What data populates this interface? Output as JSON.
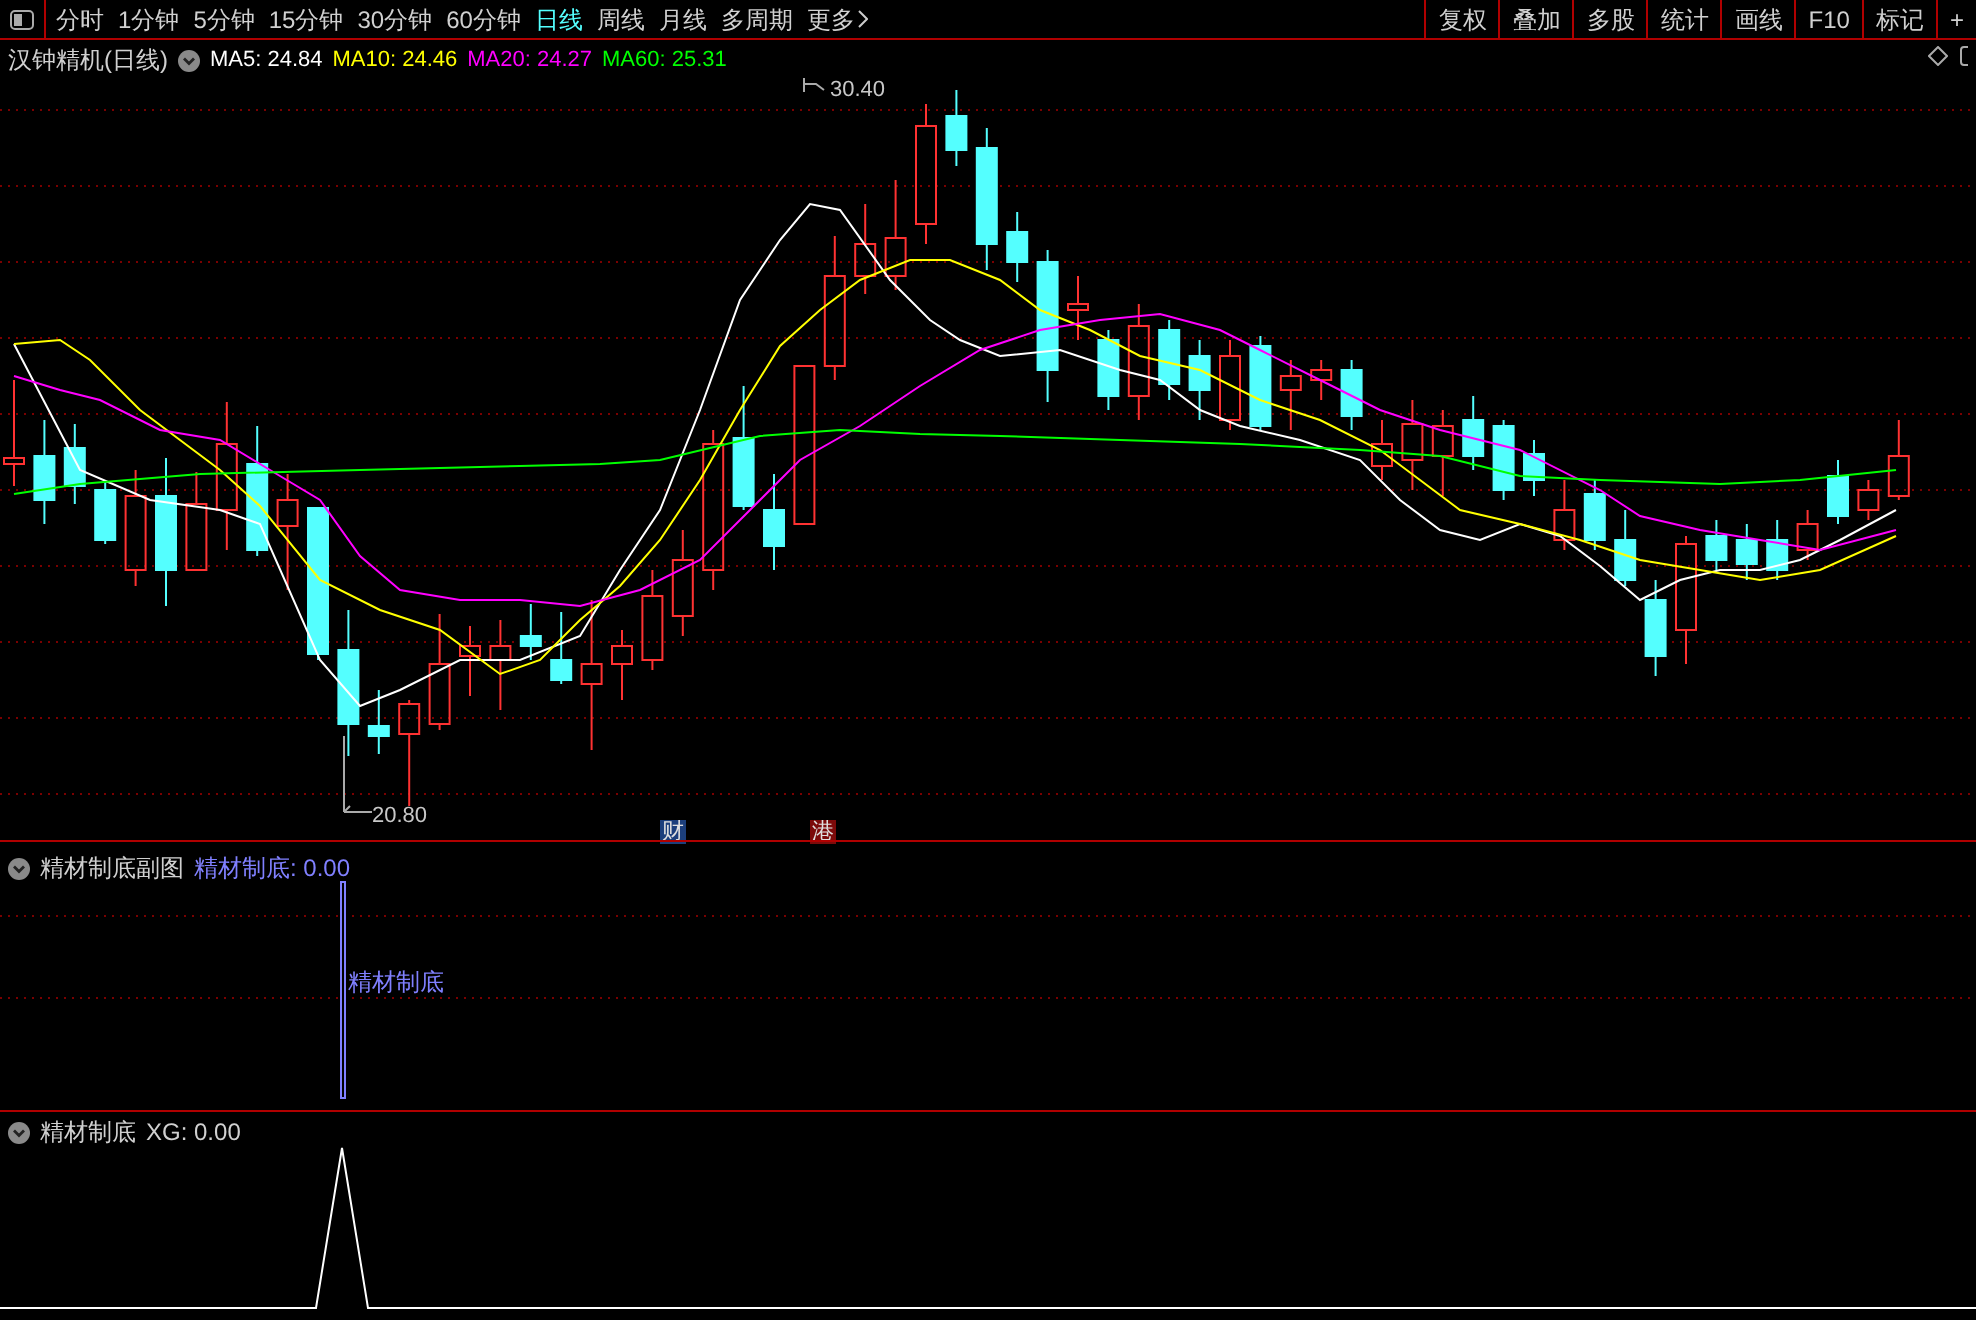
{
  "toolbar": {
    "periods": [
      {
        "label": "分时",
        "selected": false
      },
      {
        "label": "1分钟",
        "selected": false
      },
      {
        "label": "5分钟",
        "selected": false
      },
      {
        "label": "15分钟",
        "selected": false
      },
      {
        "label": "30分钟",
        "selected": false
      },
      {
        "label": "60分钟",
        "selected": false
      },
      {
        "label": "日线",
        "selected": true
      },
      {
        "label": "周线",
        "selected": false
      },
      {
        "label": "月线",
        "selected": false
      },
      {
        "label": "多周期",
        "selected": false
      }
    ],
    "more": "更多",
    "tools": [
      "复权",
      "叠加",
      "多股",
      "统计",
      "画线",
      "F10",
      "标记",
      "+"
    ]
  },
  "legend": {
    "title": "汉钟精机(日线)",
    "items": [
      {
        "text": "MA5: 24.84",
        "color": "#ffffff"
      },
      {
        "text": "MA10: 24.46",
        "color": "#ffff00"
      },
      {
        "text": "MA20: 24.27",
        "color": "#ff00ff"
      },
      {
        "text": "MA60: 25.31",
        "color": "#00ff00"
      }
    ]
  },
  "main_chart": {
    "high_label": "30.40",
    "low_label": "20.80",
    "markers": [
      {
        "text": "财",
        "color": "#1c3f7c"
      },
      {
        "text": "港",
        "color": "#7c0a0a"
      }
    ]
  },
  "indicator_1": {
    "title": "精材制底副图",
    "value": "精材制底: 0.00",
    "bar_label": "精材制底"
  },
  "indicator_2": {
    "title": "精材制底",
    "value": "XG: 0.00"
  }
}
